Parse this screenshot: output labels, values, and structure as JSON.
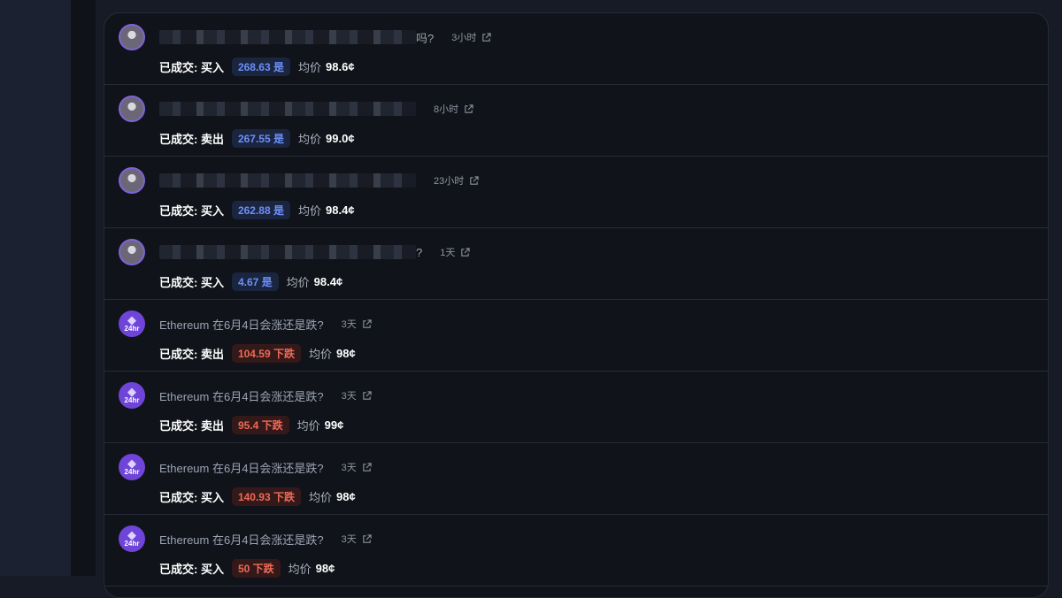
{
  "colors": {
    "yes_pill_text": "#6e8ff7",
    "no_pill_text": "#ef6a55",
    "avatar_purple": "#6f45d9",
    "background": "#101319"
  },
  "rows": [
    {
      "title": "吗?",
      "time": "3小时",
      "action": "已成交: 买入",
      "shares": "268.63 是",
      "side": "yes",
      "avg_label": "均价",
      "avg_value": "98.6¢",
      "avatar": "person-avatar"
    },
    {
      "title": "",
      "time": "8小时",
      "action": "已成交: 卖出",
      "shares": "267.55 是",
      "side": "yes",
      "avg_label": "均价",
      "avg_value": "99.0¢",
      "avatar": "person-avatar"
    },
    {
      "title": "",
      "time": "23小时",
      "action": "已成交: 买入",
      "shares": "262.88 是",
      "side": "yes",
      "avg_label": "均价",
      "avg_value": "98.4¢",
      "avatar": "person-avatar"
    },
    {
      "title": "?",
      "time": "1天",
      "action": "已成交: 买入",
      "shares": "4.67 是",
      "side": "yes",
      "avg_label": "均价",
      "avg_value": "98.4¢",
      "avatar": "person-avatar"
    },
    {
      "title": "Ethereum 在6月4日会涨还是跌?",
      "time": "3天",
      "action": "已成交: 卖出",
      "shares": "104.59 下跌",
      "side": "no",
      "avg_label": "均价",
      "avg_value": "98¢",
      "avatar": "ethereum-avatar"
    },
    {
      "title": "Ethereum 在6月4日会涨还是跌?",
      "time": "3天",
      "action": "已成交: 卖出",
      "shares": "95.4 下跌",
      "side": "no",
      "avg_label": "均价",
      "avg_value": "99¢",
      "avatar": "ethereum-avatar"
    },
    {
      "title": "Ethereum 在6月4日会涨还是跌?",
      "time": "3天",
      "action": "已成交: 买入",
      "shares": "140.93 下跌",
      "side": "no",
      "avg_label": "均价",
      "avg_value": "98¢",
      "avatar": "ethereum-avatar"
    },
    {
      "title": "Ethereum 在6月4日会涨还是跌?",
      "time": "3天",
      "action": "已成交: 买入",
      "shares": "50 下跌",
      "side": "no",
      "avg_label": "均价",
      "avg_value": "98¢",
      "avatar": "ethereum-avatar"
    }
  ],
  "eth_badge": "24hr"
}
